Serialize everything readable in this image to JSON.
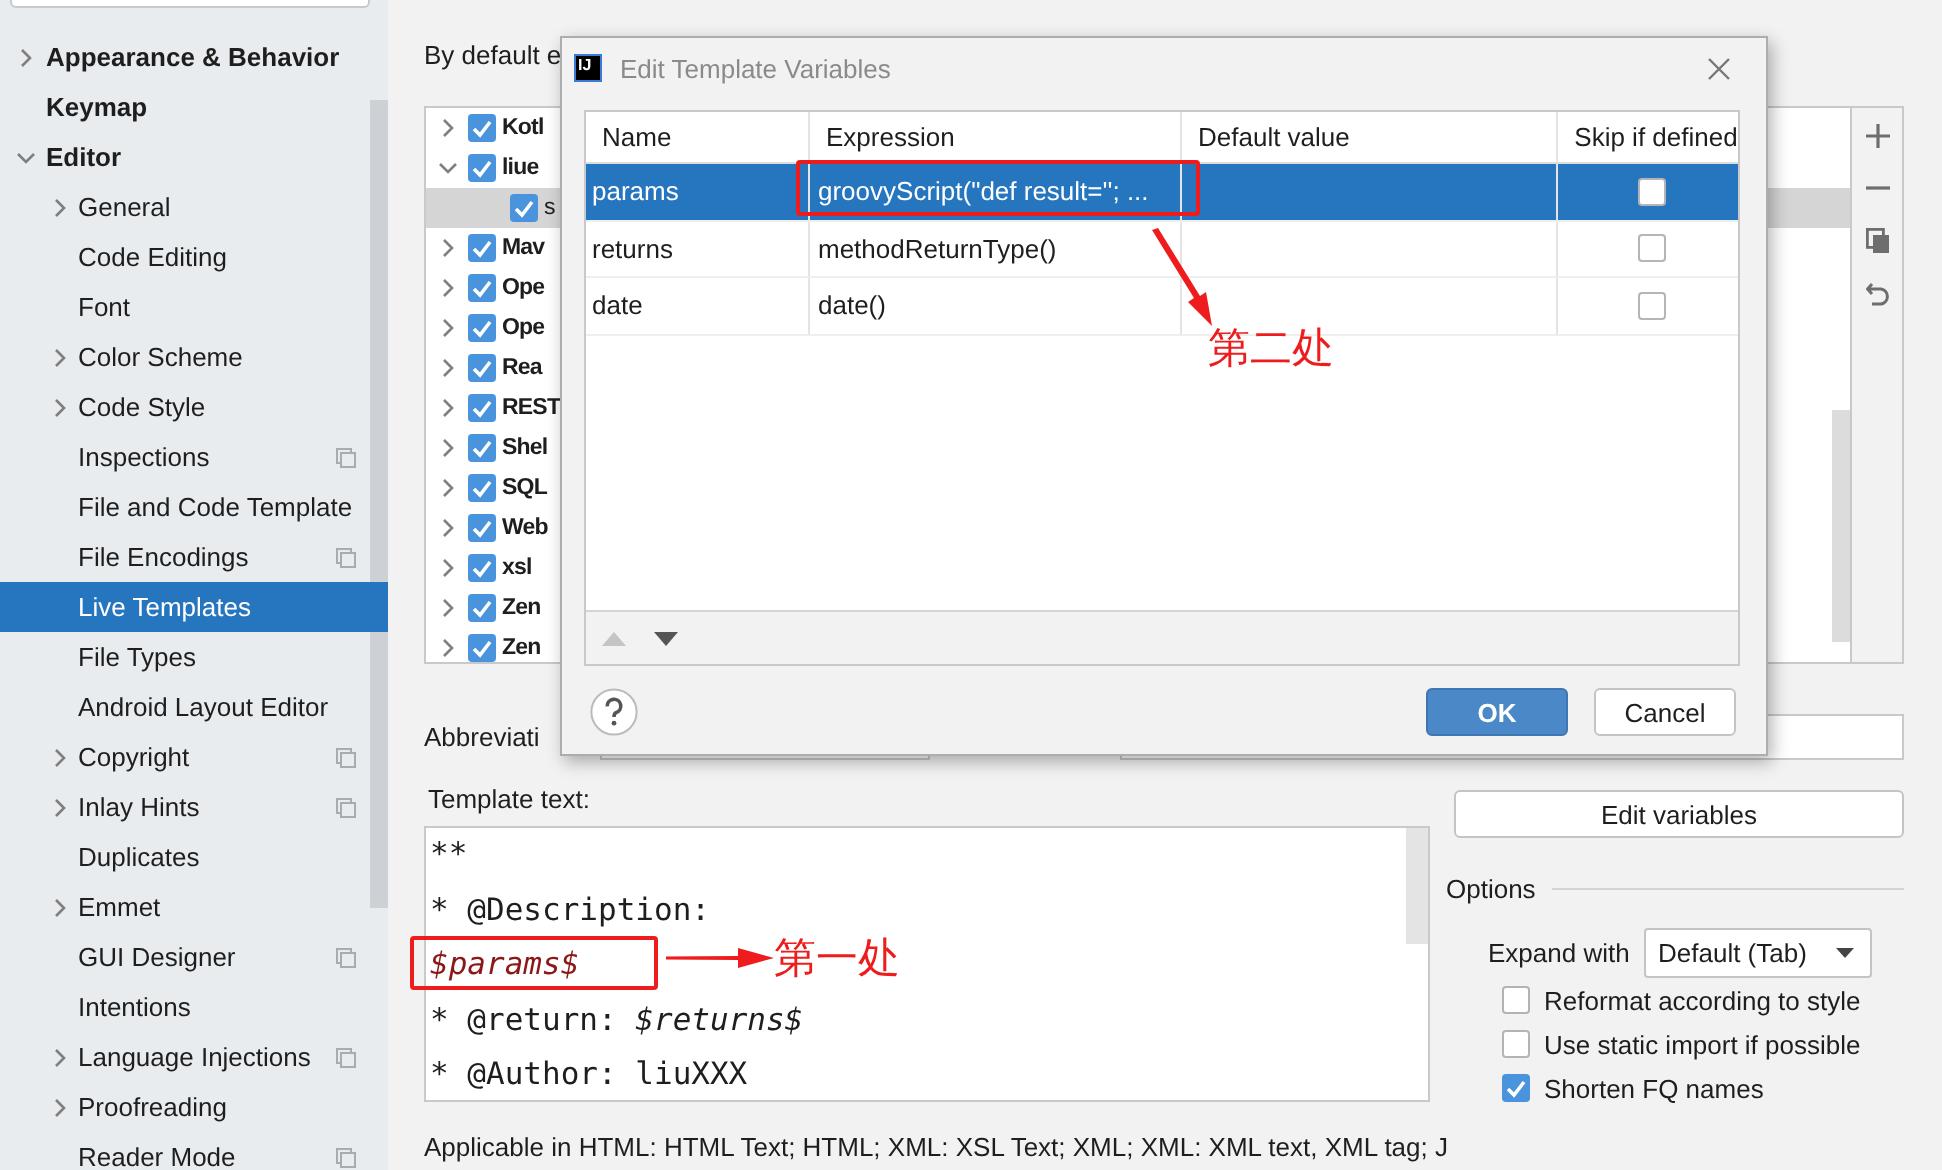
{
  "sidebar": {
    "items": [
      {
        "label": "Appearance & Behavior",
        "kind": "group",
        "expanded": false,
        "scope_icon": false
      },
      {
        "label": "Keymap",
        "kind": "leaf",
        "scope_icon": false
      },
      {
        "label": "Editor",
        "kind": "group",
        "expanded": true,
        "scope_icon": false,
        "children": [
          {
            "label": "General",
            "kind": "group",
            "expanded": false,
            "scope_icon": false,
            "selected": false
          },
          {
            "label": "Code Editing",
            "kind": "leaf",
            "scope_icon": false,
            "selected": false
          },
          {
            "label": "Font",
            "kind": "leaf",
            "scope_icon": false,
            "selected": false
          },
          {
            "label": "Color Scheme",
            "kind": "group",
            "expanded": false,
            "scope_icon": false,
            "selected": false
          },
          {
            "label": "Code Style",
            "kind": "group",
            "expanded": false,
            "scope_icon": false,
            "selected": false
          },
          {
            "label": "Inspections",
            "kind": "leaf",
            "scope_icon": true,
            "selected": false
          },
          {
            "label": "File and Code Template",
            "kind": "leaf",
            "scope_icon": false,
            "selected": false
          },
          {
            "label": "File Encodings",
            "kind": "leaf",
            "scope_icon": true,
            "selected": false
          },
          {
            "label": "Live Templates",
            "kind": "leaf",
            "scope_icon": false,
            "selected": true
          },
          {
            "label": "File Types",
            "kind": "leaf",
            "scope_icon": false,
            "selected": false
          },
          {
            "label": "Android Layout Editor",
            "kind": "leaf",
            "scope_icon": false,
            "selected": false
          },
          {
            "label": "Copyright",
            "kind": "group",
            "expanded": false,
            "scope_icon": true,
            "selected": false
          },
          {
            "label": "Inlay Hints",
            "kind": "group",
            "expanded": false,
            "scope_icon": true,
            "selected": false
          },
          {
            "label": "Duplicates",
            "kind": "leaf",
            "scope_icon": false,
            "selected": false
          },
          {
            "label": "Emmet",
            "kind": "group",
            "expanded": false,
            "scope_icon": false,
            "selected": false
          },
          {
            "label": "GUI Designer",
            "kind": "leaf",
            "scope_icon": true,
            "selected": false
          },
          {
            "label": "Intentions",
            "kind": "leaf",
            "scope_icon": false,
            "selected": false
          },
          {
            "label": "Language Injections",
            "kind": "group",
            "expanded": false,
            "scope_icon": true,
            "selected": false
          },
          {
            "label": "Proofreading",
            "kind": "group",
            "expanded": false,
            "scope_icon": false,
            "selected": false
          },
          {
            "label": "Reader Mode",
            "kind": "leaf",
            "scope_icon": true,
            "selected": false
          }
        ]
      }
    ]
  },
  "settings": {
    "expand_label": "By default e",
    "template_groups": [
      {
        "label": "Kotl",
        "checked": true,
        "expanded": false,
        "selected": false
      },
      {
        "label": "liue",
        "checked": true,
        "expanded": true,
        "selected": false,
        "children": [
          {
            "label": "s",
            "checked": true,
            "selected": true
          }
        ]
      },
      {
        "label": "Mav",
        "checked": true,
        "expanded": false,
        "selected": false
      },
      {
        "label": "Ope",
        "checked": true,
        "expanded": false,
        "selected": false
      },
      {
        "label": "Ope",
        "checked": true,
        "expanded": false,
        "selected": false
      },
      {
        "label": "Rea",
        "checked": true,
        "expanded": false,
        "selected": false
      },
      {
        "label": "REST",
        "checked": true,
        "expanded": false,
        "selected": false
      },
      {
        "label": "Shel",
        "checked": true,
        "expanded": false,
        "selected": false
      },
      {
        "label": "SQL",
        "checked": true,
        "expanded": false,
        "selected": false
      },
      {
        "label": "Web",
        "checked": true,
        "expanded": false,
        "selected": false
      },
      {
        "label": "xsl",
        "checked": true,
        "expanded": false,
        "selected": false
      },
      {
        "label": "Zen",
        "checked": true,
        "expanded": false,
        "selected": false
      },
      {
        "label": "Zen",
        "checked": true,
        "expanded": false,
        "selected": false
      }
    ],
    "abbreviation_label": "Abbreviati",
    "template_text_label": "Template text:",
    "template_lines": [
      {
        "text": "**",
        "kind": "plain",
        "highlighted": false
      },
      {
        "text": "* @Description:",
        "kind": "plain",
        "highlighted": false
      },
      {
        "text": "$params$",
        "kind": "variable",
        "highlighted": true
      },
      {
        "text": "* @return: *$returns$*",
        "kind": "plain",
        "highlighted": false
      },
      {
        "text": "* @Author: liuXXX",
        "kind": "plain",
        "highlighted": false
      }
    ],
    "edit_variables_button": "Edit variables",
    "options_title": "Options",
    "expand_with": {
      "label": "Expand with",
      "value": "Default (Tab)"
    },
    "options": [
      {
        "label": "Reformat according to style",
        "checked": false
      },
      {
        "label": "Use static import if possible",
        "checked": false
      },
      {
        "label": "Shorten FQ names",
        "checked": true
      }
    ],
    "applicable": "Applicable in HTML: HTML Text; HTML; XML: XSL Text; XML; XML: XML text, XML tag; J"
  },
  "dialog": {
    "logo": "IJ",
    "title": "Edit Template Variables",
    "columns": [
      "Name",
      "Expression",
      "Default value",
      "Skip if defined"
    ],
    "rows": [
      {
        "name": "params",
        "expression": "groovyScript(\"def result=''; ...",
        "skip_if_defined": false,
        "selected": true,
        "highlighted": true
      },
      {
        "name": "returns",
        "expression": "methodReturnType()",
        "skip_if_defined": false,
        "selected": false,
        "highlighted": false
      },
      {
        "name": "date",
        "expression": "date()",
        "skip_if_defined": false,
        "selected": false,
        "highlighted": false
      }
    ],
    "buttons": [
      {
        "label": "OK",
        "kind": "primary"
      },
      {
        "label": "Cancel",
        "kind": "secondary"
      }
    ]
  },
  "callouts": [
    {
      "text": "第二处",
      "kind": "diagonal"
    },
    {
      "text": "第一处",
      "kind": "horizontal"
    }
  ]
}
